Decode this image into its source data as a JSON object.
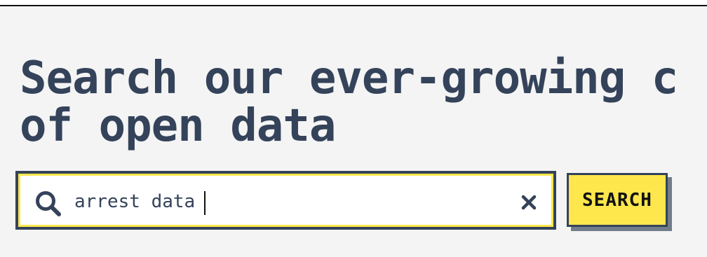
{
  "colors": {
    "heading": "#34435a",
    "accent_yellow": "#fde74c",
    "background": "#f4f4f4",
    "border_dark": "#34435a",
    "shadow": "#727d8a"
  },
  "hero": {
    "headline": "Search our ever-growing c\nof open data"
  },
  "search": {
    "value": "arrest data",
    "icon": "search-icon",
    "clear_icon": "close-icon",
    "button_label": "SEARCH"
  }
}
